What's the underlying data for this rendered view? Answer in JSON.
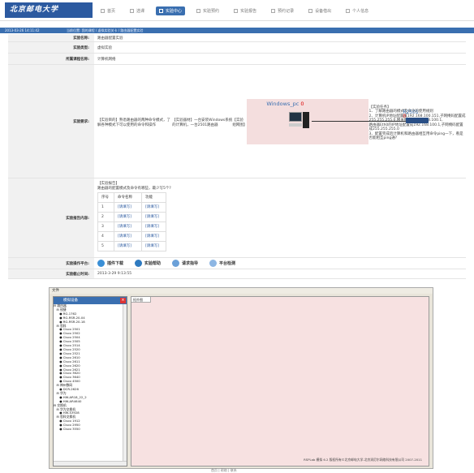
{
  "header": {
    "logo": "北京邮电大学",
    "nav": [
      {
        "label": "首页",
        "active": false
      },
      {
        "label": "选课",
        "active": false
      },
      {
        "label": "实验中心",
        "active": true
      },
      {
        "label": "实验预约",
        "active": false
      },
      {
        "label": "实验报告",
        "active": false
      },
      {
        "label": "预约记录",
        "active": false
      },
      {
        "label": "设备借出",
        "active": false
      },
      {
        "label": "个人信息",
        "active": false
      }
    ]
  },
  "infobar": {
    "date": "2013-03-26 14:11:42",
    "breadcrumb": "当前位置: 我的课程 / 虚拟实验关卡 / 路由器配置实验"
  },
  "form": {
    "name_label": "实验名称:",
    "name_value": "路由器配置实验",
    "type_label": "实验类型:",
    "type_value": "虚拟实验",
    "course_label": "所属课程名称:",
    "course_value": "计算机网络",
    "req_label": "实验要求:",
    "req_lines": [
      "【实验目的】熟悉路由器的两种命令模式，了解各种模式下可以使用的命令和操作",
      "【实验器材】一台安装Windows系统的计算机，一台2501路由器",
      "【实验组网图】"
    ],
    "topo_pc": "Windows_pc",
    "topo_pc_port": "0",
    "topo_router": "R2501",
    "topo_router_port": "0",
    "task_lines": [
      "【实验任务】",
      "1、了解路由器的模式及命令的使用规则",
      "2、计算机IP地址配置成192.168.100.151,子网掩码配置成255.255.255.0,网关配置成192.168.100.1,",
      "    路由器Eth0的IP地址配置成192.168.100.1,子网掩码配置成255.255.255.0",
      "3、配置完成后计算机和路由器相互用命令ping一下，看是否能相互ping通?"
    ],
    "report_label": "实验报告内容:",
    "report_intro_1": "【实验报告】",
    "report_intro_2": "路由器的配置模式及命令有哪些，最少写5个?",
    "steps_header": [
      "序号",
      "命令名称",
      "功能"
    ],
    "steps_rows": [
      [
        "1",
        "[请填写]",
        "[请填写]"
      ],
      [
        "2",
        "[请填写]",
        "[请填写]"
      ],
      [
        "3",
        "[请填写]",
        "[请填写]"
      ],
      [
        "4",
        "[请填写]",
        "[请填写]"
      ],
      [
        "5",
        "[请填写]",
        "[请填写]"
      ]
    ],
    "platform_label": "实验操作平台:",
    "buttons": [
      {
        "label": "插件下载",
        "color": "#3a8fd6"
      },
      {
        "label": "实验帮助",
        "color": "#2e7ac0"
      },
      {
        "label": "请求指导",
        "color": "#6aa0d8"
      },
      {
        "label": "平台检测",
        "color": "#8db6e3"
      }
    ],
    "deadline_label": "实验截止时间:",
    "deadline_value": "2013-3-29 9:13:55"
  },
  "app": {
    "menu": "文件",
    "tree_title": "模拟设备",
    "tree_close": "×",
    "tree_items": [
      "⊟ 路由器",
      "   ⊟ 锐捷",
      "      ● RG-1762",
      "      ● RG-RSR-20-04",
      "      ● RG-RSR-20-18",
      "   ⊟ 思科",
      "      ● Cisco 2501",
      "      ● Cisco 2502",
      "      ● Cisco 2504",
      "      ● Cisco 2505",
      "      ● Cisco 2514",
      "      ● Cisco 2520",
      "      ● Cisco 2521",
      "      ● Cisco 2610",
      "      ● Cisco 2611",
      "      ● Cisco 2620",
      "      ● Cisco 2621",
      "      ● Cisco 3620",
      "      ● Cisco 3640",
      "      ● Cisco 4500",
      "   ⊟ 神州数码",
      "      ● DCR-2626",
      "   ⊟ 华为",
      "      ● HW-AR18_22_2",
      "      ● HW-AR4640",
      "⊟ 交换机",
      "   ⊟ 华为交换机",
      "      ● HW-S3928",
      "   ⊟ 思科交换机",
      "      ● Cisco 1912",
      "      ● Cisco 2950",
      "      ● Cisco 3550"
    ],
    "canvas_tab": "拓扑图",
    "footer": "RSPLab 模拟 6.2  版权所有©北京邮电大学-北京润尼尔网络科技有限公司 2007-2011"
  },
  "bottom": "首页 | 帮助 | 联系"
}
